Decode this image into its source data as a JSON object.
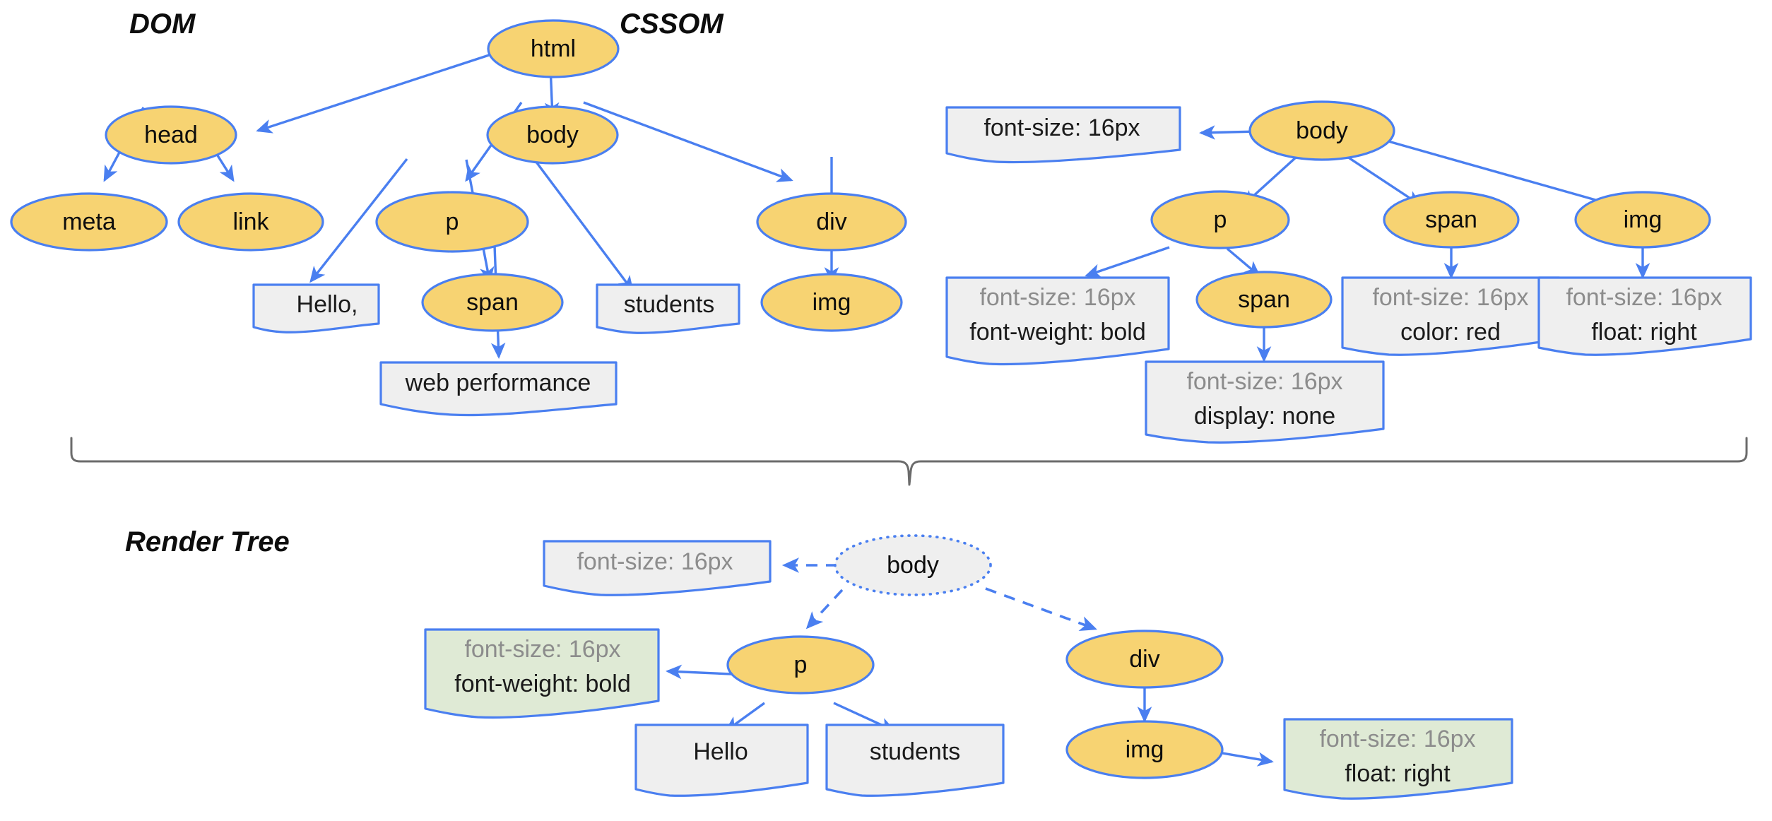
{
  "sections": {
    "dom": {
      "title": "DOM"
    },
    "cssom": {
      "title": "CSSOM"
    },
    "render": {
      "title": "Render Tree"
    }
  },
  "dom_tree": {
    "nodes": [
      {
        "id": "html",
        "label": "html",
        "type": "element"
      },
      {
        "id": "head",
        "label": "head",
        "type": "element"
      },
      {
        "id": "body",
        "label": "body",
        "type": "element"
      },
      {
        "id": "meta",
        "label": "meta",
        "type": "element"
      },
      {
        "id": "link",
        "label": "link",
        "type": "element"
      },
      {
        "id": "p",
        "label": "p",
        "type": "element"
      },
      {
        "id": "div",
        "label": "div",
        "type": "element"
      },
      {
        "id": "span",
        "label": "span",
        "type": "element"
      },
      {
        "id": "img",
        "label": "img",
        "type": "element"
      },
      {
        "id": "hello",
        "label": "Hello,",
        "type": "text"
      },
      {
        "id": "students",
        "label": "students",
        "type": "text"
      },
      {
        "id": "webperf",
        "label": "web performance",
        "type": "text"
      }
    ],
    "edges": [
      [
        "html",
        "head"
      ],
      [
        "html",
        "body"
      ],
      [
        "head",
        "meta"
      ],
      [
        "head",
        "link"
      ],
      [
        "body",
        "p"
      ],
      [
        "body",
        "div"
      ],
      [
        "p",
        "hello"
      ],
      [
        "p",
        "span"
      ],
      [
        "p",
        "students"
      ],
      [
        "span",
        "webperf"
      ],
      [
        "div",
        "img"
      ]
    ]
  },
  "cssom_tree": {
    "nodes": [
      {
        "id": "body",
        "label": "body",
        "type": "element"
      },
      {
        "id": "p",
        "label": "p",
        "type": "element"
      },
      {
        "id": "span1",
        "label": "span",
        "type": "element"
      },
      {
        "id": "span2",
        "label": "span",
        "type": "element"
      },
      {
        "id": "img",
        "label": "img",
        "type": "element"
      }
    ],
    "rule_boxes": [
      {
        "id": "r-body",
        "inherited": "font-size: 16px",
        "own": ""
      },
      {
        "id": "r-p",
        "inherited": "font-size: 16px",
        "own": "font-weight: bold"
      },
      {
        "id": "r-span1",
        "inherited": "font-size: 16px",
        "own": "display: none"
      },
      {
        "id": "r-span2",
        "inherited": "font-size: 16px",
        "own": "color: red"
      },
      {
        "id": "r-img",
        "inherited": "font-size: 16px",
        "own": "float: right"
      }
    ]
  },
  "render_tree": {
    "nodes": [
      {
        "id": "body",
        "label": "body",
        "type": "ghost"
      },
      {
        "id": "p",
        "label": "p",
        "type": "element"
      },
      {
        "id": "div",
        "label": "div",
        "type": "element"
      },
      {
        "id": "img",
        "label": "img",
        "type": "element"
      },
      {
        "id": "hello",
        "label": "Hello",
        "type": "text"
      },
      {
        "id": "students",
        "label": "students",
        "type": "text"
      }
    ],
    "rule_boxes": [
      {
        "id": "r-body",
        "inherited": "font-size: 16px",
        "own": "",
        "style": "grey"
      },
      {
        "id": "r-p",
        "inherited": "font-size: 16px",
        "own": "font-weight: bold",
        "style": "green"
      },
      {
        "id": "r-img",
        "inherited": "font-size: 16px",
        "own": "float: right",
        "style": "green"
      }
    ]
  },
  "colors": {
    "node_fill": "#f7d372",
    "node_stroke": "#4a7ff0",
    "text_box_fill": "#efefef",
    "render_box_fill": "#dfead5",
    "edge": "#4a7ff0",
    "brace": "#6b6b6b",
    "muted_text": "#8c8c8c"
  }
}
